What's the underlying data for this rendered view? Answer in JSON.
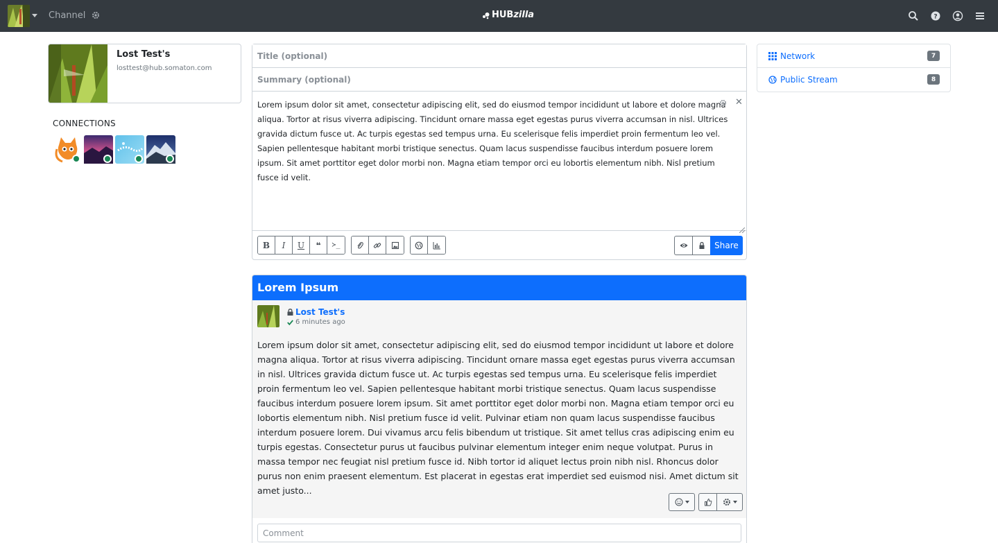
{
  "navbar": {
    "channel_label": "Channel",
    "brand": {
      "hub": "HUB",
      "zilla": "zilla"
    },
    "icons": [
      "search-icon",
      "help-icon",
      "user-circle-icon",
      "menu-icon"
    ]
  },
  "profile": {
    "name": "Lost Test's",
    "address": "losttest@hub.somaton.com"
  },
  "connections": {
    "title": "CONNECTIONS",
    "items": [
      {
        "name": "cat-avatar",
        "online": true
      },
      {
        "name": "purple-sky-avatar",
        "online": true
      },
      {
        "name": "blue-sky-avatar",
        "online": true
      },
      {
        "name": "mountain-avatar",
        "online": true
      }
    ]
  },
  "editor": {
    "title_placeholder": "Title (optional)",
    "summary_placeholder": "Summary (optional)",
    "body": "Lorem ipsum dolor sit amet, consectetur adipiscing elit, sed do eiusmod tempor incididunt ut labore et dolore magna aliqua. Tortor at risus viverra adipiscing. Tincidunt ornare massa eget egestas purus viverra accumsan in nisl. Ultrices gravida dictum fusce ut. Ac turpis egestas sed tempus urna. Eu scelerisque felis imperdiet proin fermentum leo vel. Sapien pellentesque habitant morbi tristique senectus. Quam lacus suspendisse faucibus interdum posuere lorem ipsum. Sit amet porttitor eget dolor morbi non. Magna etiam tempor orci eu lobortis elementum nibh. Nisl pretium fusce id velit.",
    "toolbar": {
      "bold": "B",
      "italic": "I",
      "underline": "U",
      "quote": "❝",
      "code": "≻_"
    },
    "share_label": "Share"
  },
  "post": {
    "title": "Lorem Ipsum",
    "author": "Lost Test's",
    "time": "6 minutes ago",
    "body": "Lorem ipsum dolor sit amet, consectetur adipiscing elit, sed do eiusmod tempor incididunt ut labore et dolore magna aliqua. Tortor at risus viverra adipiscing. Tincidunt ornare massa eget egestas purus viverra accumsan in nisl. Ultrices gravida dictum fusce ut. Ac turpis egestas sed tempus urna. Eu scelerisque felis imperdiet proin fermentum leo vel. Sapien pellentesque habitant morbi tristique senectus. Quam lacus suspendisse faucibus interdum posuere lorem ipsum. Sit amet porttitor eget dolor morbi non. Magna etiam tempor orci eu lobortis elementum nibh. Nisl pretium fusce id velit. Pulvinar etiam non quam lacus suspendisse faucibus interdum posuere lorem. Dui vivamus arcu felis bibendum ut tristique. Sit amet tellus cras adipiscing enim eu turpis egestas. Consectetur purus ut faucibus pulvinar elementum integer enim neque volutpat. Purus in massa tempor nec feugiat nisl pretium fusce id. Nibh tortor id aliquet lectus proin nibh nisl. Rhoncus dolor purus non enim praesent elementum. Est placerat in egestas erat imperdiet sed euismod nisi. Amet dictum sit amet justo...",
    "comment_placeholder": "Comment"
  },
  "right_nav": {
    "items": [
      {
        "label": "Network",
        "count": "7"
      },
      {
        "label": "Public Stream",
        "count": "8"
      }
    ]
  },
  "colors": {
    "navbar": "#343a40",
    "primary": "#0d6efd",
    "online": "#198754",
    "badge": "#6c757d"
  }
}
